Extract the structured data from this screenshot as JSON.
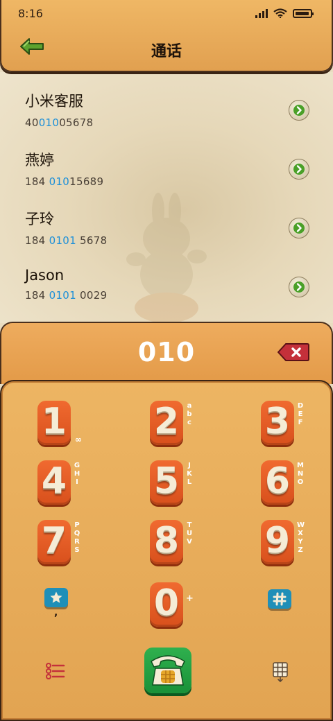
{
  "status": {
    "time": "8:16"
  },
  "header": {
    "title": "通话"
  },
  "contacts": [
    {
      "name": "小米客服",
      "num_pre": "40",
      "num_hl": "010",
      "num_post": "05678"
    },
    {
      "name": "燕婷",
      "num_pre": "184 ",
      "num_hl": "010",
      "num_post": "15689"
    },
    {
      "name": "子玲",
      "num_pre": "184 ",
      "num_hl": "0101",
      "num_post": " 5678"
    },
    {
      "name": "Jason",
      "num_pre": "184 ",
      "num_hl": "0101",
      "num_post": " 0029"
    }
  ],
  "dial": {
    "number": "010"
  },
  "keys": [
    {
      "digit": "1",
      "letters": "∞"
    },
    {
      "digit": "2",
      "letters": "abc"
    },
    {
      "digit": "3",
      "letters": "DEF"
    },
    {
      "digit": "4",
      "letters": "GHI"
    },
    {
      "digit": "5",
      "letters": "JKL"
    },
    {
      "digit": "6",
      "letters": "MNO"
    },
    {
      "digit": "7",
      "letters": "PQRS"
    },
    {
      "digit": "8",
      "letters": "TUV"
    },
    {
      "digit": "9",
      "letters": "WXYZ"
    },
    {
      "digit": "0",
      "letters": "+"
    }
  ],
  "star_key": {
    "sub": ","
  },
  "colors": {
    "accent_blue": "#1c8fd8",
    "clay_orange": "#e9a450",
    "key_red": "#e45a24",
    "call_green": "#1f9a3e"
  }
}
